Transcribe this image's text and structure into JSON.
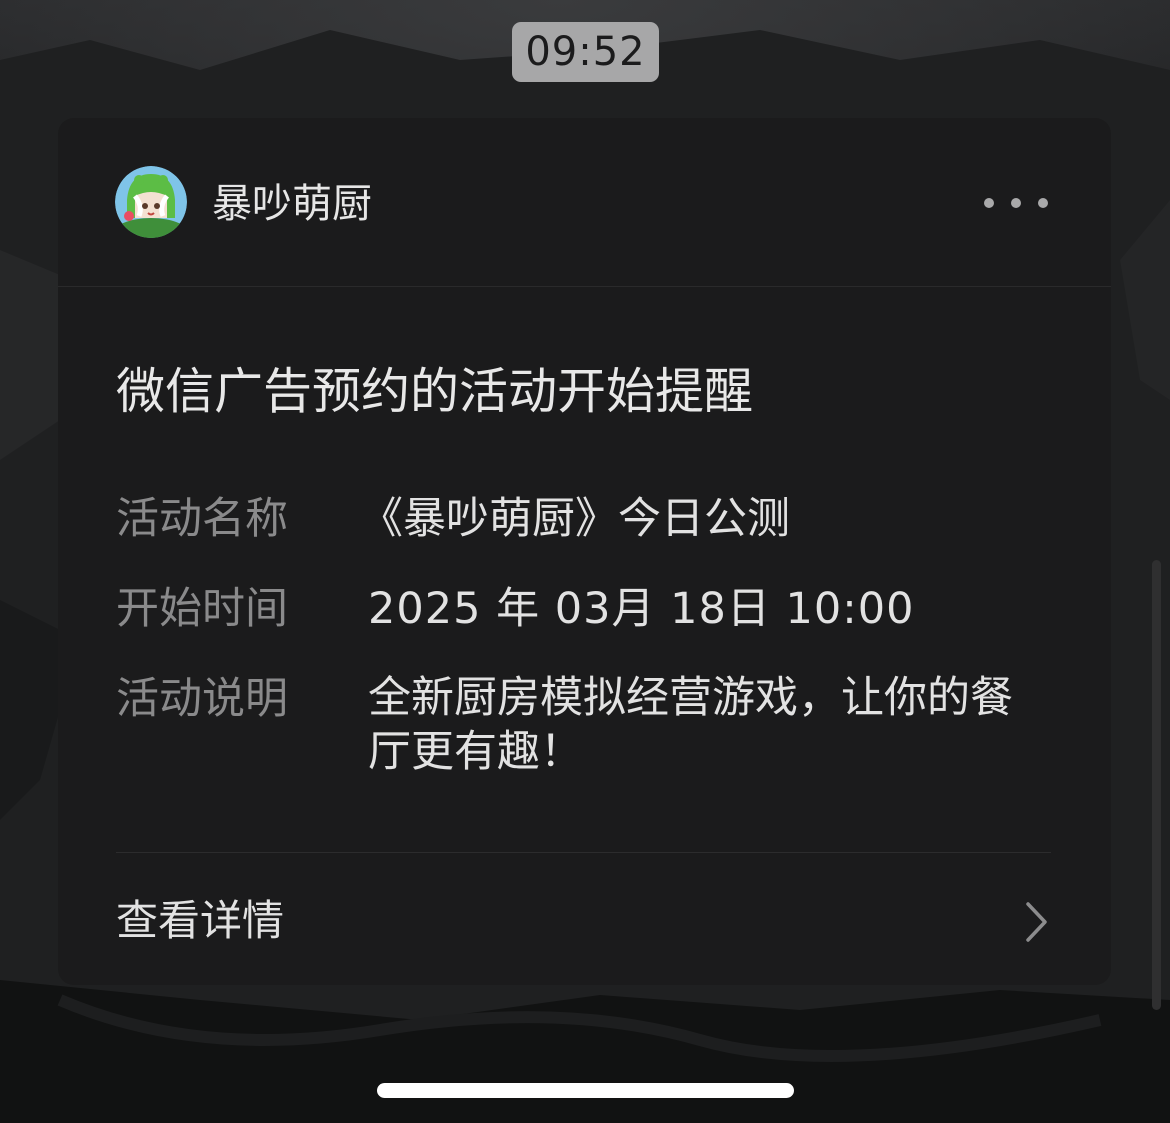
{
  "status": {
    "time": "09:52"
  },
  "card": {
    "app_name": "暴吵萌厨",
    "title": "微信广告预约的活动开始提醒",
    "fields": [
      {
        "label": "活动名称",
        "value": "《暴吵萌厨》今日公测"
      },
      {
        "label": "开始时间",
        "value": "2025 年 03月 18日 10:00"
      },
      {
        "label": "活动说明",
        "value": "全新厨房模拟经营游戏，让你的餐厅更有趣！"
      }
    ],
    "detail_label": "查看详情"
  },
  "icons": {
    "avatar": "game-avatar-green-dino-icon",
    "more": "more-dots-icon",
    "chevron": "chevron-right-icon"
  },
  "colors": {
    "card_bg": "#1b1b1c",
    "time_pill_bg": "#a7a7a8",
    "label_gray": "#8a8a8b",
    "text_light": "#e2e2e2"
  }
}
